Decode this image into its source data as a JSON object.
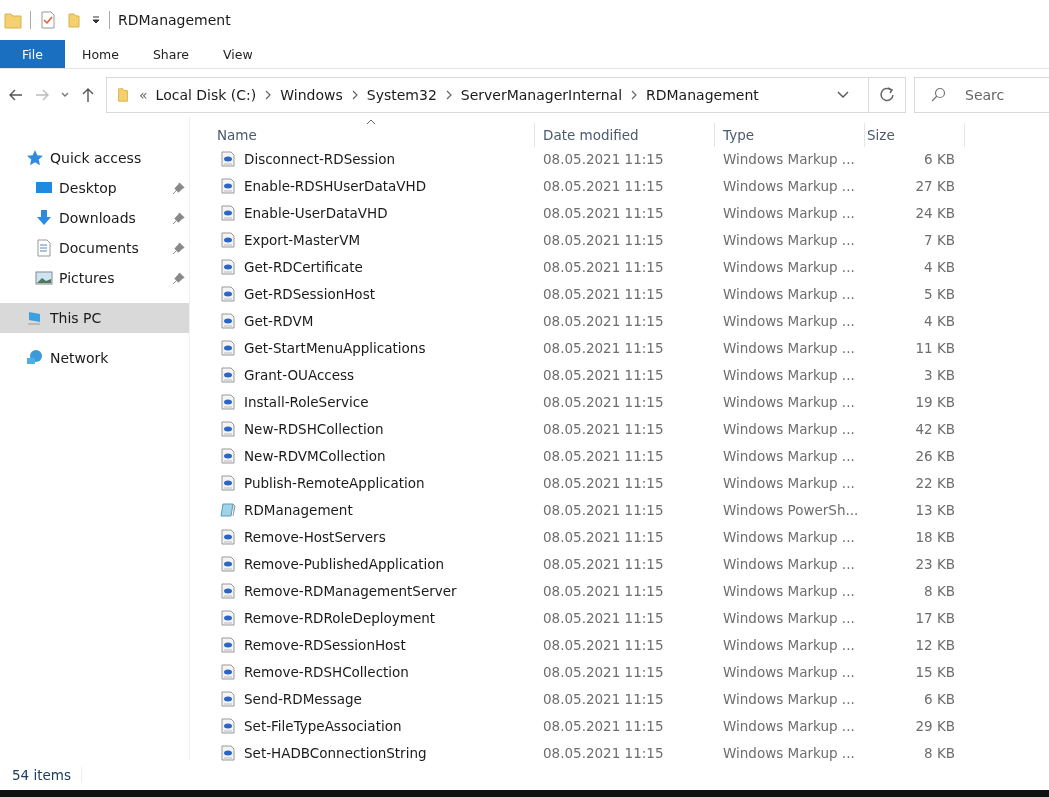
{
  "window": {
    "title": "RDManagement"
  },
  "ribbon_tabs": [
    {
      "label": "File",
      "selected": true
    },
    {
      "label": "Home",
      "selected": false
    },
    {
      "label": "Share",
      "selected": false
    },
    {
      "label": "View",
      "selected": false
    }
  ],
  "address": {
    "overflow": "«",
    "crumbs": [
      "Local Disk (C:)",
      "Windows",
      "System32",
      "ServerManagerInternal",
      "RDManagement"
    ]
  },
  "search": {
    "placeholder": "Searc"
  },
  "sidebar": {
    "items": [
      {
        "label": "Quick access",
        "kind": "star",
        "pinned": false,
        "selected": false,
        "children": [
          {
            "label": "Desktop",
            "kind": "desktop",
            "pinned": true,
            "selected": false
          },
          {
            "label": "Downloads",
            "kind": "downloads",
            "pinned": true,
            "selected": false
          },
          {
            "label": "Documents",
            "kind": "documents",
            "pinned": true,
            "selected": false
          },
          {
            "label": "Pictures",
            "kind": "pictures",
            "pinned": true,
            "selected": false
          }
        ]
      },
      {
        "label": "This PC",
        "kind": "pc",
        "pinned": false,
        "selected": true
      },
      {
        "label": "Network",
        "kind": "network",
        "pinned": false,
        "selected": false
      }
    ]
  },
  "table": {
    "columns": [
      "Name",
      "Date modified",
      "Type",
      "Size"
    ],
    "rows": [
      {
        "kind": "xml",
        "name": "Disconnect-RDSession",
        "date": "08.05.2021 11:15",
        "type": "Windows Markup ...",
        "size": "6 KB"
      },
      {
        "kind": "xml",
        "name": "Enable-RDSHUserDataVHD",
        "date": "08.05.2021 11:15",
        "type": "Windows Markup ...",
        "size": "27 KB"
      },
      {
        "kind": "xml",
        "name": "Enable-UserDataVHD",
        "date": "08.05.2021 11:15",
        "type": "Windows Markup ...",
        "size": "24 KB"
      },
      {
        "kind": "xml",
        "name": "Export-MasterVM",
        "date": "08.05.2021 11:15",
        "type": "Windows Markup ...",
        "size": "7 KB"
      },
      {
        "kind": "xml",
        "name": "Get-RDCertificate",
        "date": "08.05.2021 11:15",
        "type": "Windows Markup ...",
        "size": "4 KB"
      },
      {
        "kind": "xml",
        "name": "Get-RDSessionHost",
        "date": "08.05.2021 11:15",
        "type": "Windows Markup ...",
        "size": "5 KB"
      },
      {
        "kind": "xml",
        "name": "Get-RDVM",
        "date": "08.05.2021 11:15",
        "type": "Windows Markup ...",
        "size": "4 KB"
      },
      {
        "kind": "xml",
        "name": "Get-StartMenuApplications",
        "date": "08.05.2021 11:15",
        "type": "Windows Markup ...",
        "size": "11 KB"
      },
      {
        "kind": "xml",
        "name": "Grant-OUAccess",
        "date": "08.05.2021 11:15",
        "type": "Windows Markup ...",
        "size": "3 KB"
      },
      {
        "kind": "xml",
        "name": "Install-RoleService",
        "date": "08.05.2021 11:15",
        "type": "Windows Markup ...",
        "size": "19 KB"
      },
      {
        "kind": "xml",
        "name": "New-RDSHCollection",
        "date": "08.05.2021 11:15",
        "type": "Windows Markup ...",
        "size": "42 KB"
      },
      {
        "kind": "xml",
        "name": "New-RDVMCollection",
        "date": "08.05.2021 11:15",
        "type": "Windows Markup ...",
        "size": "26 KB"
      },
      {
        "kind": "xml",
        "name": "Publish-RemoteApplication",
        "date": "08.05.2021 11:15",
        "type": "Windows Markup ...",
        "size": "22 KB"
      },
      {
        "kind": "ps",
        "name": "RDManagement",
        "date": "08.05.2021 11:15",
        "type": "Windows PowerSh...",
        "size": "13 KB"
      },
      {
        "kind": "xml",
        "name": "Remove-HostServers",
        "date": "08.05.2021 11:15",
        "type": "Windows Markup ...",
        "size": "18 KB"
      },
      {
        "kind": "xml",
        "name": "Remove-PublishedApplication",
        "date": "08.05.2021 11:15",
        "type": "Windows Markup ...",
        "size": "23 KB"
      },
      {
        "kind": "xml",
        "name": "Remove-RDManagementServer",
        "date": "08.05.2021 11:15",
        "type": "Windows Markup ...",
        "size": "8 KB"
      },
      {
        "kind": "xml",
        "name": "Remove-RDRoleDeployment",
        "date": "08.05.2021 11:15",
        "type": "Windows Markup ...",
        "size": "17 KB"
      },
      {
        "kind": "xml",
        "name": "Remove-RDSessionHost",
        "date": "08.05.2021 11:15",
        "type": "Windows Markup ...",
        "size": "12 KB"
      },
      {
        "kind": "xml",
        "name": "Remove-RDSHCollection",
        "date": "08.05.2021 11:15",
        "type": "Windows Markup ...",
        "size": "15 KB"
      },
      {
        "kind": "xml",
        "name": "Send-RDMessage",
        "date": "08.05.2021 11:15",
        "type": "Windows Markup ...",
        "size": "6 KB"
      },
      {
        "kind": "xml",
        "name": "Set-FileTypeAssociation",
        "date": "08.05.2021 11:15",
        "type": "Windows Markup ...",
        "size": "29 KB"
      },
      {
        "kind": "xml",
        "name": "Set-HADBConnectionString",
        "date": "08.05.2021 11:15",
        "type": "Windows Markup ...",
        "size": "8 KB"
      }
    ]
  },
  "status_bar": {
    "count": "54 items"
  }
}
